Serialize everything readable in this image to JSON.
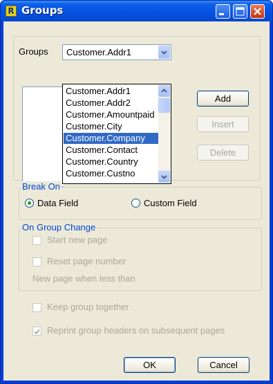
{
  "window": {
    "title": "Groups",
    "app_icon_letter": "R"
  },
  "groups": {
    "label": "Groups",
    "selected_value": "Customer.Addr1"
  },
  "dropdown": {
    "options": [
      "Customer.Addr1",
      "Customer.Addr2",
      "Customer.Amountpaid",
      "Customer.City",
      "Customer.Company",
      "Customer.Contact",
      "Customer.Country",
      "Customer.Custno"
    ],
    "highlighted": "Customer.Company"
  },
  "buttons": {
    "add": "Add",
    "insert": "Insert",
    "delete": "Delete",
    "ok": "OK",
    "cancel": "Cancel"
  },
  "break_on": {
    "title": "Break On",
    "data_field": "Data Field",
    "custom_field": "Custom Field",
    "selected": "Data Field"
  },
  "on_group_change": {
    "title": "On Group Change",
    "start_new_page": "Start new page",
    "reset_page_number": "Reset page number",
    "new_page_when": "New page when less than"
  },
  "options": {
    "keep_together": "Keep group together",
    "reprint_headers": "Reprint group headers on subsequent pages",
    "reprint_checked": true,
    "keep_checked": false
  },
  "colors": {
    "title_bar": "#0451e0",
    "dialog_bg": "#ece9d8",
    "group_label": "#0046d5",
    "selection": "#316ac5"
  }
}
